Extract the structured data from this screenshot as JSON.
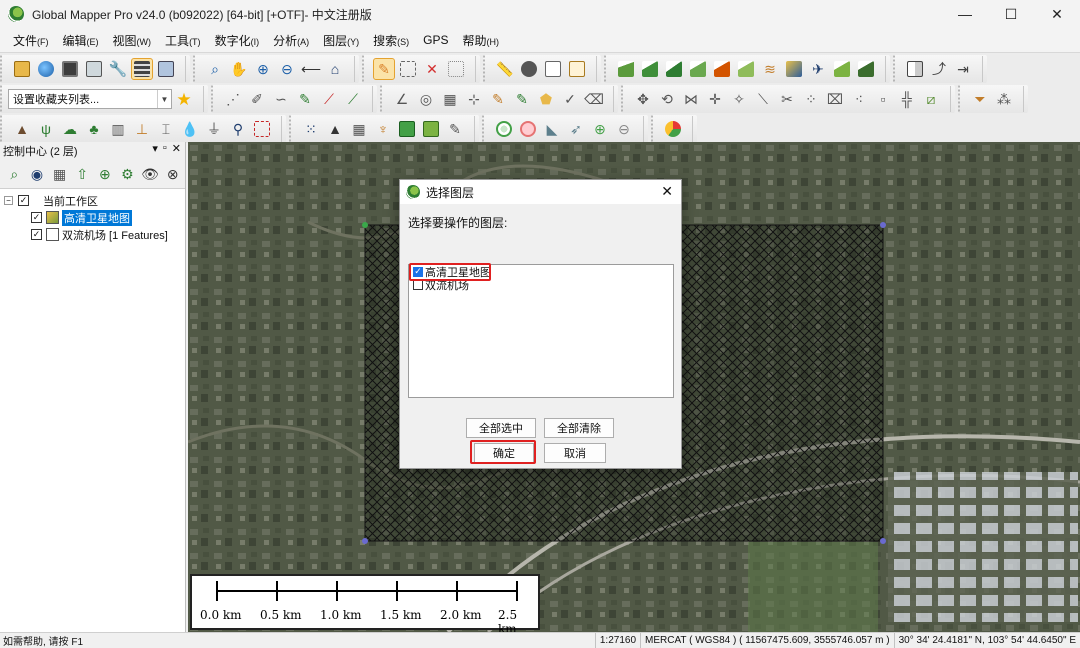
{
  "window": {
    "title": "Global Mapper Pro v24.0 (b092022) [64-bit] [+OTF]- 中文注册版",
    "minimize": "—",
    "maximize": "☐",
    "close": "✕"
  },
  "menu": [
    {
      "label": "文件",
      "key": "(F)"
    },
    {
      "label": "编辑",
      "key": "(E)"
    },
    {
      "label": "视图",
      "key": "(W)"
    },
    {
      "label": "工具",
      "key": "(T)"
    },
    {
      "label": "数字化",
      "key": "(I)"
    },
    {
      "label": "分析",
      "key": "(A)"
    },
    {
      "label": "图层",
      "key": "(Y)"
    },
    {
      "label": "搜索",
      "key": "(S)"
    },
    {
      "label": "GPS",
      "key": ""
    },
    {
      "label": "帮助",
      "key": "(H)"
    }
  ],
  "toolbar": {
    "favorites_placeholder": "设置收藏夹列表..."
  },
  "control_center": {
    "title": "控制中心 (2 层)",
    "workspace_label": "当前工作区",
    "layers": [
      {
        "name": "高清卫星地图",
        "checked": true,
        "selected": true
      },
      {
        "name": "双流机场 [1 Features]",
        "checked": true,
        "selected": false
      }
    ]
  },
  "dialog": {
    "title": "选择图层",
    "prompt": "选择要操作的图层:",
    "items": [
      {
        "label": "高清卫星地图",
        "checked": true
      },
      {
        "label": "双流机场",
        "checked": false
      }
    ],
    "select_all": "全部选中",
    "clear_all": "全部清除",
    "ok": "确定",
    "cancel": "取消"
  },
  "scale_bar": {
    "labels": [
      "0.0 km",
      "0.5 km",
      "1.0 km",
      "1.5 km",
      "2.0 km",
      "2.5 km"
    ]
  },
  "status_bar": {
    "help": "如需帮助, 请按 F1",
    "scale": "1:27160",
    "projection": "MERCAT ( WGS84 ) ( 11567475.609, 3555746.057 m )",
    "coords": "30° 34' 24.4181\" N, 103° 54' 44.6450\" E"
  },
  "colors": {
    "highlight": "#e02020",
    "selection": "#0078d7",
    "checkbox_on": "#1a73e8"
  }
}
